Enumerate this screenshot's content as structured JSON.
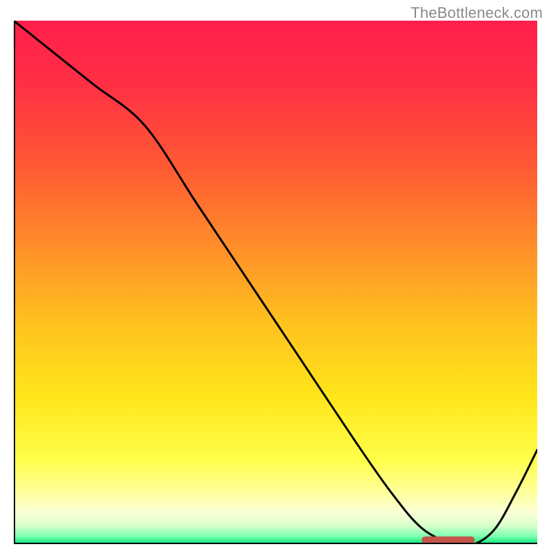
{
  "watermark": "TheBottleneck.com",
  "colors": {
    "gradient_stops": [
      {
        "offset": 0.0,
        "color": "#ff1f4b"
      },
      {
        "offset": 0.12,
        "color": "#ff2f45"
      },
      {
        "offset": 0.28,
        "color": "#ff5a33"
      },
      {
        "offset": 0.42,
        "color": "#ff8a2a"
      },
      {
        "offset": 0.58,
        "color": "#ffc21f"
      },
      {
        "offset": 0.72,
        "color": "#ffe61a"
      },
      {
        "offset": 0.84,
        "color": "#ffff4a"
      },
      {
        "offset": 0.9,
        "color": "#ffff9a"
      },
      {
        "offset": 0.94,
        "color": "#faffd6"
      },
      {
        "offset": 0.965,
        "color": "#d6ffc9"
      },
      {
        "offset": 0.985,
        "color": "#7dffb0"
      },
      {
        "offset": 1.0,
        "color": "#00e676"
      }
    ],
    "axis": "#000000",
    "curve": "#000000",
    "marker_fill": "#c4544a",
    "marker_stroke": "#c4544a"
  },
  "chart_data": {
    "type": "line",
    "title": "",
    "xlabel": "",
    "ylabel": "",
    "xlim": [
      0,
      100
    ],
    "ylim": [
      0,
      100
    ],
    "grid": false,
    "legend": false,
    "series": [
      {
        "name": "bottleneck-curve",
        "x": [
          0,
          5,
          15,
          25,
          35,
          45,
          55,
          65,
          72,
          78,
          84,
          88,
          92,
          96,
          100
        ],
        "values": [
          100,
          96,
          88,
          80,
          65,
          50,
          35,
          20,
          10,
          3,
          0,
          0,
          3,
          10,
          18
        ]
      }
    ],
    "marker": {
      "name": "optimal-range-bar",
      "x_start": 78,
      "x_end": 88,
      "y": 0.8,
      "height": 1.2
    },
    "annotations": []
  }
}
